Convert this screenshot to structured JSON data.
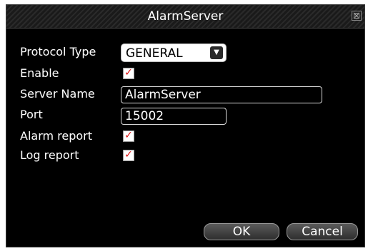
{
  "dialog": {
    "title": "AlarmServer",
    "close_glyph": "⊠"
  },
  "form": {
    "protocol_type_label": "Protocol Type",
    "protocol_type_value": "GENERAL",
    "enable_label": "Enable",
    "enable_checked": true,
    "server_name_label": "Server Name",
    "server_name_value": "AlarmServer",
    "port_label": "Port",
    "port_value": "15002",
    "alarm_report_label": "Alarm report",
    "alarm_report_checked": true,
    "log_report_label": "Log report",
    "log_report_checked": true,
    "check_glyph": "✓",
    "dropdown_glyph": "▼"
  },
  "buttons": {
    "ok_label": "OK",
    "cancel_label": "Cancel"
  },
  "colors": {
    "check_mark": "#dd1111",
    "background": "#000000"
  }
}
